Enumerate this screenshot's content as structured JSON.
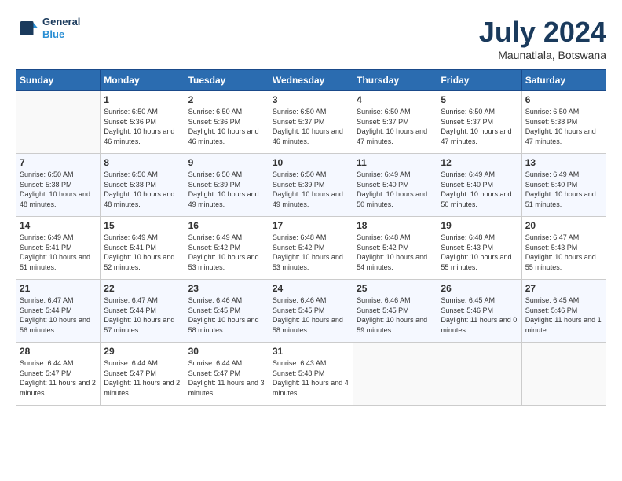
{
  "header": {
    "logo_line1": "General",
    "logo_line2": "Blue",
    "month_year": "July 2024",
    "location": "Maunatlala, Botswana"
  },
  "days_of_week": [
    "Sunday",
    "Monday",
    "Tuesday",
    "Wednesday",
    "Thursday",
    "Friday",
    "Saturday"
  ],
  "weeks": [
    [
      {
        "day": "",
        "sunrise": "",
        "sunset": "",
        "daylight": ""
      },
      {
        "day": "1",
        "sunrise": "Sunrise: 6:50 AM",
        "sunset": "Sunset: 5:36 PM",
        "daylight": "Daylight: 10 hours and 46 minutes."
      },
      {
        "day": "2",
        "sunrise": "Sunrise: 6:50 AM",
        "sunset": "Sunset: 5:36 PM",
        "daylight": "Daylight: 10 hours and 46 minutes."
      },
      {
        "day": "3",
        "sunrise": "Sunrise: 6:50 AM",
        "sunset": "Sunset: 5:37 PM",
        "daylight": "Daylight: 10 hours and 46 minutes."
      },
      {
        "day": "4",
        "sunrise": "Sunrise: 6:50 AM",
        "sunset": "Sunset: 5:37 PM",
        "daylight": "Daylight: 10 hours and 47 minutes."
      },
      {
        "day": "5",
        "sunrise": "Sunrise: 6:50 AM",
        "sunset": "Sunset: 5:37 PM",
        "daylight": "Daylight: 10 hours and 47 minutes."
      },
      {
        "day": "6",
        "sunrise": "Sunrise: 6:50 AM",
        "sunset": "Sunset: 5:38 PM",
        "daylight": "Daylight: 10 hours and 47 minutes."
      }
    ],
    [
      {
        "day": "7",
        "sunrise": "Sunrise: 6:50 AM",
        "sunset": "Sunset: 5:38 PM",
        "daylight": "Daylight: 10 hours and 48 minutes."
      },
      {
        "day": "8",
        "sunrise": "Sunrise: 6:50 AM",
        "sunset": "Sunset: 5:38 PM",
        "daylight": "Daylight: 10 hours and 48 minutes."
      },
      {
        "day": "9",
        "sunrise": "Sunrise: 6:50 AM",
        "sunset": "Sunset: 5:39 PM",
        "daylight": "Daylight: 10 hours and 49 minutes."
      },
      {
        "day": "10",
        "sunrise": "Sunrise: 6:50 AM",
        "sunset": "Sunset: 5:39 PM",
        "daylight": "Daylight: 10 hours and 49 minutes."
      },
      {
        "day": "11",
        "sunrise": "Sunrise: 6:49 AM",
        "sunset": "Sunset: 5:40 PM",
        "daylight": "Daylight: 10 hours and 50 minutes."
      },
      {
        "day": "12",
        "sunrise": "Sunrise: 6:49 AM",
        "sunset": "Sunset: 5:40 PM",
        "daylight": "Daylight: 10 hours and 50 minutes."
      },
      {
        "day": "13",
        "sunrise": "Sunrise: 6:49 AM",
        "sunset": "Sunset: 5:40 PM",
        "daylight": "Daylight: 10 hours and 51 minutes."
      }
    ],
    [
      {
        "day": "14",
        "sunrise": "Sunrise: 6:49 AM",
        "sunset": "Sunset: 5:41 PM",
        "daylight": "Daylight: 10 hours and 51 minutes."
      },
      {
        "day": "15",
        "sunrise": "Sunrise: 6:49 AM",
        "sunset": "Sunset: 5:41 PM",
        "daylight": "Daylight: 10 hours and 52 minutes."
      },
      {
        "day": "16",
        "sunrise": "Sunrise: 6:49 AM",
        "sunset": "Sunset: 5:42 PM",
        "daylight": "Daylight: 10 hours and 53 minutes."
      },
      {
        "day": "17",
        "sunrise": "Sunrise: 6:48 AM",
        "sunset": "Sunset: 5:42 PM",
        "daylight": "Daylight: 10 hours and 53 minutes."
      },
      {
        "day": "18",
        "sunrise": "Sunrise: 6:48 AM",
        "sunset": "Sunset: 5:42 PM",
        "daylight": "Daylight: 10 hours and 54 minutes."
      },
      {
        "day": "19",
        "sunrise": "Sunrise: 6:48 AM",
        "sunset": "Sunset: 5:43 PM",
        "daylight": "Daylight: 10 hours and 55 minutes."
      },
      {
        "day": "20",
        "sunrise": "Sunrise: 6:47 AM",
        "sunset": "Sunset: 5:43 PM",
        "daylight": "Daylight: 10 hours and 55 minutes."
      }
    ],
    [
      {
        "day": "21",
        "sunrise": "Sunrise: 6:47 AM",
        "sunset": "Sunset: 5:44 PM",
        "daylight": "Daylight: 10 hours and 56 minutes."
      },
      {
        "day": "22",
        "sunrise": "Sunrise: 6:47 AM",
        "sunset": "Sunset: 5:44 PM",
        "daylight": "Daylight: 10 hours and 57 minutes."
      },
      {
        "day": "23",
        "sunrise": "Sunrise: 6:46 AM",
        "sunset": "Sunset: 5:45 PM",
        "daylight": "Daylight: 10 hours and 58 minutes."
      },
      {
        "day": "24",
        "sunrise": "Sunrise: 6:46 AM",
        "sunset": "Sunset: 5:45 PM",
        "daylight": "Daylight: 10 hours and 58 minutes."
      },
      {
        "day": "25",
        "sunrise": "Sunrise: 6:46 AM",
        "sunset": "Sunset: 5:45 PM",
        "daylight": "Daylight: 10 hours and 59 minutes."
      },
      {
        "day": "26",
        "sunrise": "Sunrise: 6:45 AM",
        "sunset": "Sunset: 5:46 PM",
        "daylight": "Daylight: 11 hours and 0 minutes."
      },
      {
        "day": "27",
        "sunrise": "Sunrise: 6:45 AM",
        "sunset": "Sunset: 5:46 PM",
        "daylight": "Daylight: 11 hours and 1 minute."
      }
    ],
    [
      {
        "day": "28",
        "sunrise": "Sunrise: 6:44 AM",
        "sunset": "Sunset: 5:47 PM",
        "daylight": "Daylight: 11 hours and 2 minutes."
      },
      {
        "day": "29",
        "sunrise": "Sunrise: 6:44 AM",
        "sunset": "Sunset: 5:47 PM",
        "daylight": "Daylight: 11 hours and 2 minutes."
      },
      {
        "day": "30",
        "sunrise": "Sunrise: 6:44 AM",
        "sunset": "Sunset: 5:47 PM",
        "daylight": "Daylight: 11 hours and 3 minutes."
      },
      {
        "day": "31",
        "sunrise": "Sunrise: 6:43 AM",
        "sunset": "Sunset: 5:48 PM",
        "daylight": "Daylight: 11 hours and 4 minutes."
      },
      {
        "day": "",
        "sunrise": "",
        "sunset": "",
        "daylight": ""
      },
      {
        "day": "",
        "sunrise": "",
        "sunset": "",
        "daylight": ""
      },
      {
        "day": "",
        "sunrise": "",
        "sunset": "",
        "daylight": ""
      }
    ]
  ]
}
